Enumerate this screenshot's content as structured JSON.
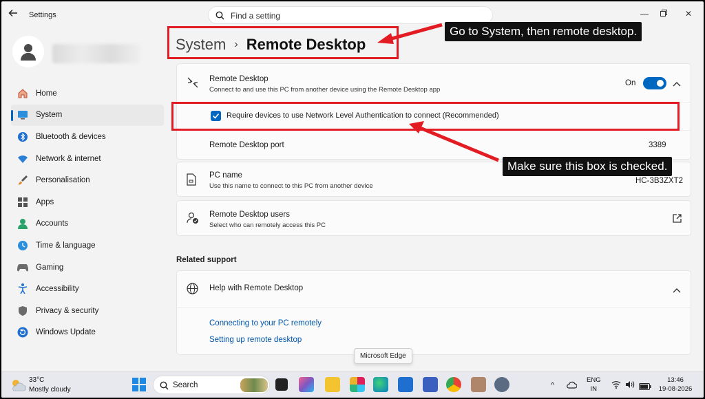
{
  "window": {
    "title": "Settings",
    "search_placeholder": "Find a setting"
  },
  "sidebar": {
    "items": [
      {
        "label": "Home",
        "icon": "home-icon",
        "active": false
      },
      {
        "label": "System",
        "icon": "system-icon",
        "active": true
      },
      {
        "label": "Bluetooth & devices",
        "icon": "bluetooth-icon",
        "active": false
      },
      {
        "label": "Network & internet",
        "icon": "wifi-icon",
        "active": false
      },
      {
        "label": "Personalisation",
        "icon": "brush-icon",
        "active": false
      },
      {
        "label": "Apps",
        "icon": "apps-icon",
        "active": false
      },
      {
        "label": "Accounts",
        "icon": "accounts-icon",
        "active": false
      },
      {
        "label": "Time & language",
        "icon": "clock-globe-icon",
        "active": false
      },
      {
        "label": "Gaming",
        "icon": "gamepad-icon",
        "active": false
      },
      {
        "label": "Accessibility",
        "icon": "accessibility-icon",
        "active": false
      },
      {
        "label": "Privacy & security",
        "icon": "shield-icon",
        "active": false
      },
      {
        "label": "Windows Update",
        "icon": "update-icon",
        "active": false
      }
    ]
  },
  "breadcrumb": {
    "parent": "System",
    "separator": "›",
    "current": "Remote Desktop"
  },
  "remote_desktop": {
    "title": "Remote Desktop",
    "subtitle": "Connect to and use this PC from another device using the Remote Desktop app",
    "state_label": "On",
    "toggle_on": true,
    "nla_label": "Require devices to use Network Level Authentication to connect (Recommended)",
    "nla_checked": true,
    "port_label": "Remote Desktop port",
    "port_value": "3389"
  },
  "pc_name": {
    "title": "PC name",
    "subtitle": "Use this name to connect to this PC from another device",
    "value": "HC-3B3ZXT2"
  },
  "users": {
    "title": "Remote Desktop users",
    "subtitle": "Select who can remotely access this PC"
  },
  "related": {
    "heading": "Related support",
    "help_title": "Help with Remote Desktop",
    "links": [
      "Connecting to your PC remotely",
      "Setting up remote desktop"
    ]
  },
  "annotations": {
    "callout_1": "Go to System, then remote desktop.",
    "callout_2": "Make sure this box is checked.",
    "color": "#e31b23"
  },
  "tooltip": "Microsoft Edge",
  "taskbar": {
    "temperature": "33°C",
    "condition": "Mostly cloudy",
    "search_label": "Search",
    "lang": "ENG",
    "region": "IN",
    "time": "13:46",
    "date": "19-08-2026"
  },
  "colors": {
    "accent": "#0067c0",
    "annotation": "#e31b23",
    "link": "#0055a8"
  }
}
